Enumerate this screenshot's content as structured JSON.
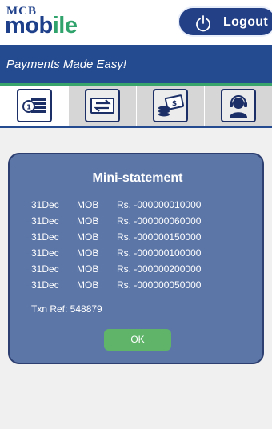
{
  "header": {
    "logo_top": "MCB",
    "logo_main_a": "mob",
    "logo_main_b": "ile",
    "logout_label": "Logout"
  },
  "banner": {
    "tagline": "Payments Made Easy!"
  },
  "tabs": [
    {
      "icon": "statement-icon",
      "active": true
    },
    {
      "icon": "transfer-icon",
      "active": false
    },
    {
      "icon": "bill-payment-icon",
      "active": false
    },
    {
      "icon": "support-agent-icon",
      "active": false
    }
  ],
  "dialog": {
    "title": "Mini-statement",
    "transactions": [
      {
        "date": "31Dec",
        "type": "MOB",
        "amount": "Rs. -000000010000"
      },
      {
        "date": "31Dec",
        "type": "MOB",
        "amount": "Rs. -000000060000"
      },
      {
        "date": "31Dec",
        "type": "MOB",
        "amount": "Rs. -000000150000"
      },
      {
        "date": "31Dec",
        "type": "MOB",
        "amount": "Rs. -000000100000"
      },
      {
        "date": "31Dec",
        "type": "MOB",
        "amount": "Rs. -000000200000"
      },
      {
        "date": "31Dec",
        "type": "MOB",
        "amount": "Rs. -000000050000"
      }
    ],
    "txn_ref": "Txn Ref: 548879",
    "ok_label": "OK"
  },
  "colors": {
    "brand_blue": "#244a8f",
    "brand_green": "#3aa56b",
    "dialog_bg": "#5c76a8",
    "ok_green": "#5fb46a"
  }
}
